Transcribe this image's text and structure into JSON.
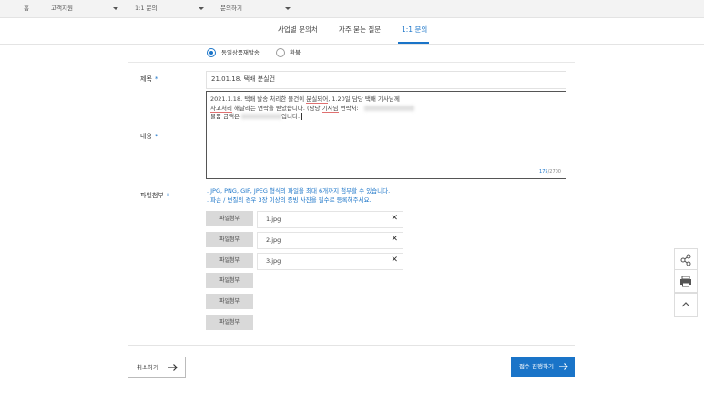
{
  "breadcrumb": {
    "home": "홈",
    "level1": "고객지원",
    "level2": "1:1 문의",
    "level3": "문의하기"
  },
  "tabs": [
    {
      "label": "사업별 문의처"
    },
    {
      "label": "자주 묻는 질문"
    },
    {
      "label": "1:1 문의"
    }
  ],
  "form": {
    "type_options": [
      {
        "label": "동일상품재발송",
        "selected": true
      },
      {
        "label": "환불",
        "selected": false
      }
    ],
    "title_label": "제목",
    "title_value": "21.01.18. 택배 분실건",
    "content_label": "내용",
    "content_line1": "2021.1.18. 택배 발송 처리한 물건이 ",
    "content_line1_und": "분실되어",
    "content_line1_tail": ", 1.20일 담당 택배 기사님께",
    "content_line2_und": "사고처리",
    "content_line2_mid": " 해달라는 연락을 받았습니다. (담당 ",
    "content_line2_und2": "기사님",
    "content_line2_tail": " 연락처:",
    "content_line3_head": "물품 금액은 ",
    "content_line3_tail": "입니다.",
    "counter_current": "175",
    "counter_max": "/2700",
    "file_label": "파일첨부",
    "file_note1": ". JPG, PNG, GIF, JPEG 형식의 파일을 최대 6개까지 첨부할 수 있습니다.",
    "file_note2": ". 파손 / 변질의 경우 3장 이상의 증빙 사진을 필수로 등록해주세요.",
    "file_button_label": "파일첨부",
    "files": [
      "1.jpg",
      "2.jpg",
      "3.jpg"
    ],
    "delete_glyph": "✕"
  },
  "actions": {
    "cancel_label": "취소하기",
    "submit_label": "접수 진행하기",
    "arrow": "→"
  },
  "colors": {
    "accent": "#1a74c8"
  },
  "icons": [
    "share-icon",
    "print-icon",
    "chevron-up-icon"
  ]
}
